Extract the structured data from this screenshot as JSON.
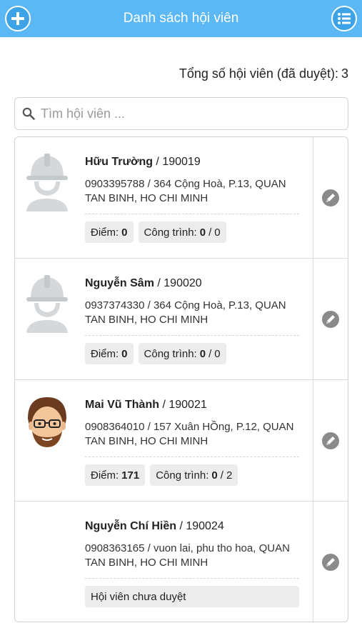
{
  "header": {
    "title": "Danh sách hội viên",
    "left_icon": "add-icon",
    "right_icon": "list-icon",
    "color": "#5bb8f5"
  },
  "summary": {
    "label": "Tổng số hội viên (đã duyệt):",
    "count": "3"
  },
  "search": {
    "placeholder": "Tìm hội viên ...",
    "value": ""
  },
  "members": [
    {
      "name": "Hữu Trường",
      "id": "190019",
      "phone": "0903395788",
      "address": "364 Cộng Hoà, P.13, QUAN TAN BINH, HO CHI MINH",
      "avatar": "worker-helmet-icon",
      "points_label": "Điểm:",
      "points": "0",
      "projects_label": "Công trình:",
      "projects_done": "0",
      "projects_total": "0"
    },
    {
      "name": "Nguyễn Sâm",
      "id": "190020",
      "phone": "0937374330",
      "address": "364 Cộng Hoà, P.13, QUAN TAN BINH, HO CHI MINH",
      "avatar": "worker-helmet-icon",
      "points_label": "Điểm:",
      "points": "0",
      "projects_label": "Công trình:",
      "projects_done": "0",
      "projects_total": "0"
    },
    {
      "name": "Mai Vũ Thành",
      "id": "190021",
      "phone": "0908364010",
      "address": "157 Xuân HỒng, P.12, QUAN TAN BINH, HO CHI MINH",
      "avatar": "cartoon-face-avatar",
      "points_label": "Điểm:",
      "points": "171",
      "projects_label": "Công trình:",
      "projects_done": "0",
      "projects_total": "2"
    },
    {
      "name": "Nguyễn Chí Hiền",
      "id": "190024",
      "phone": "0908363165",
      "address": "vuon lai, phu tho hoa, QUAN TAN BINH, HO CHI MINH",
      "avatar": "none",
      "status": "Hội viên chưa duyệt"
    }
  ]
}
